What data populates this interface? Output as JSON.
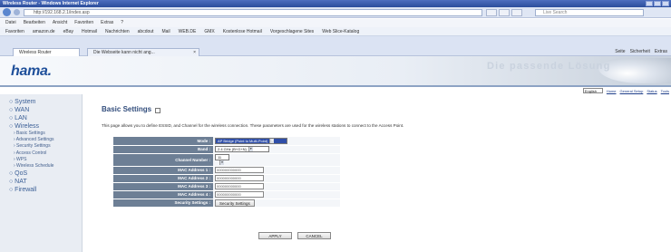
{
  "browser": {
    "window_title": "Wireless Router - Windows Internet Explorer",
    "address": "http://192.168.2.1/index.asp",
    "search_placeholder": "Live Search",
    "menu": [
      "Datei",
      "Bearbeiten",
      "Ansicht",
      "Favoriten",
      "Extras",
      "?"
    ],
    "favorites": [
      "Favoriten",
      "amazon.de",
      "eBay",
      "Hotmail",
      "Nachrichten",
      "abcdout",
      "Mail",
      "WEB.DE",
      "GMX",
      "Kostenlose Hotmail",
      "Vorgeschlagene Sites",
      "Web Slice-Katalog"
    ],
    "tabs": [
      {
        "label": "Wireless Router",
        "active": true
      },
      {
        "label": "Die Webseite kann nicht ang...",
        "active": false
      }
    ],
    "toolbar": [
      "Seite",
      "Sicherheit",
      "Extras"
    ]
  },
  "header": {
    "logo": "hama.",
    "slogan": "Die passende Lösung",
    "language": "English",
    "links": [
      "Home",
      "General Setup",
      "Status",
      "Tools"
    ]
  },
  "sidebar": {
    "items": [
      {
        "label": "System",
        "type": "main"
      },
      {
        "label": "WAN",
        "type": "main"
      },
      {
        "label": "LAN",
        "type": "main"
      },
      {
        "label": "Wireless",
        "type": "main"
      },
      {
        "label": "Basic Settings",
        "type": "sub"
      },
      {
        "label": "Advanced Settings",
        "type": "sub"
      },
      {
        "label": "Security Settings",
        "type": "sub"
      },
      {
        "label": "Access Control",
        "type": "sub"
      },
      {
        "label": "WPS",
        "type": "sub"
      },
      {
        "label": "Wireless Schedule",
        "type": "sub"
      },
      {
        "label": "QoS",
        "type": "main"
      },
      {
        "label": "NAT",
        "type": "main"
      },
      {
        "label": "Firewall",
        "type": "main"
      }
    ]
  },
  "main": {
    "title": "Basic Settings",
    "description": "This page allows you to define ESSID, and Channel for the wireless connection. These parameters are used for the wireless stations to connect to the Access Point.",
    "fields": {
      "mode": {
        "label": "Mode :",
        "value": "AP Bridge (Point to Multi-Point)"
      },
      "band": {
        "label": "Band :",
        "value": "2.4 GHz (B+G+N)"
      },
      "channel": {
        "label": "Channel Number :",
        "value": "11"
      },
      "mac1": {
        "label": "MAC Address 1 :",
        "value": "000000000000"
      },
      "mac2": {
        "label": "MAC Address 2 :",
        "value": "000000000000"
      },
      "mac3": {
        "label": "MAC Address 3 :",
        "value": "000000000000"
      },
      "mac4": {
        "label": "MAC Address 4 :",
        "value": "000000000000"
      },
      "security": {
        "label": "Security Settings :",
        "button": "Security Settings"
      }
    },
    "apply": "APPLY",
    "cancel": "CANCEL"
  }
}
